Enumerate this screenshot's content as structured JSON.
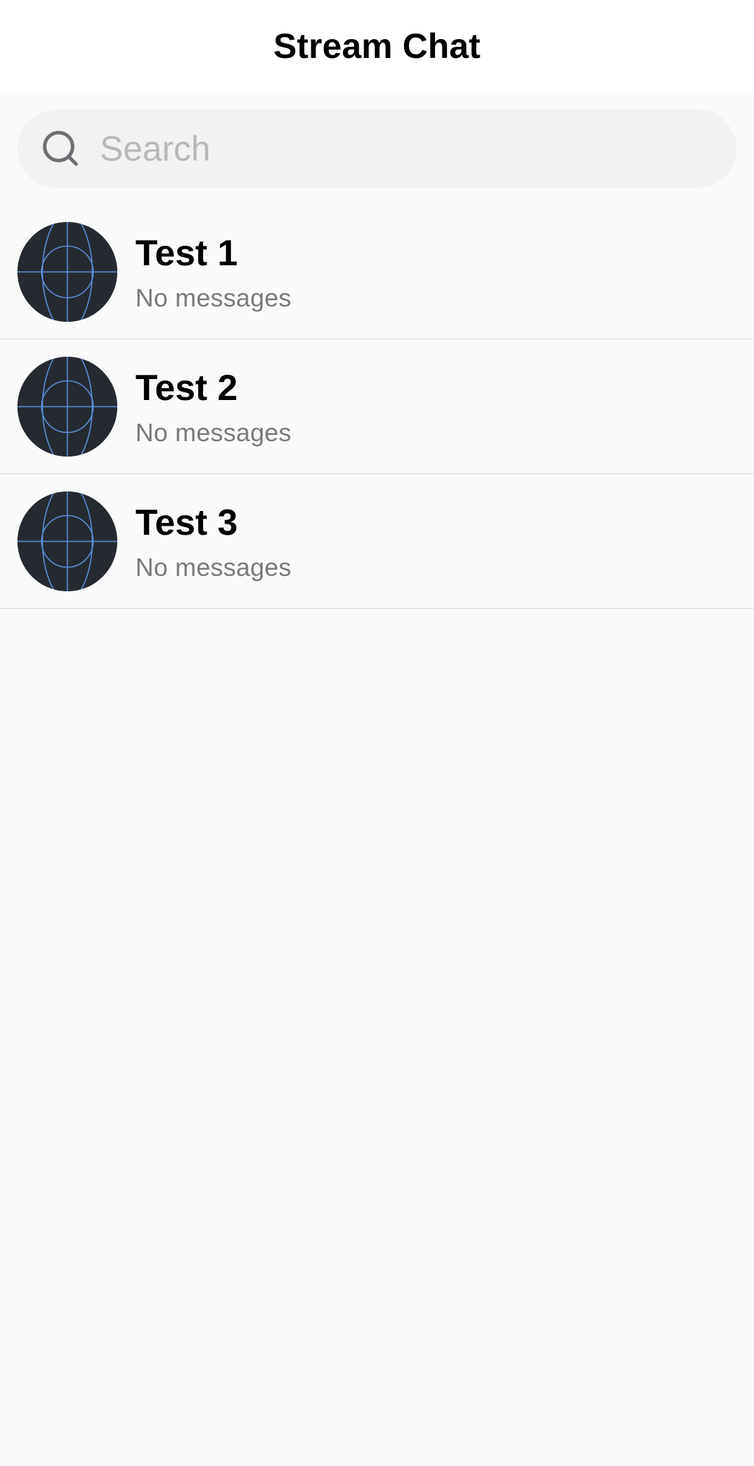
{
  "header": {
    "title": "Stream Chat"
  },
  "search": {
    "placeholder": "Search",
    "value": "",
    "icon": "search-icon"
  },
  "channels": [
    {
      "name": "Test 1",
      "preview": "No messages",
      "avatar_icon": "avatar-icon"
    },
    {
      "name": "Test 2",
      "preview": "No messages",
      "avatar_icon": "avatar-icon"
    },
    {
      "name": "Test 3",
      "preview": "No messages",
      "avatar_icon": "avatar-icon"
    }
  ],
  "colors": {
    "header_bg": "#ffffff",
    "page_bg": "#fafafa",
    "search_bg": "#f2f2f2",
    "placeholder": "#b8b8b8",
    "preview_text": "#7a7a7a",
    "divider": "#d6d6d6",
    "avatar_bg": "#252a30",
    "avatar_lines": "#5b8fd9"
  }
}
